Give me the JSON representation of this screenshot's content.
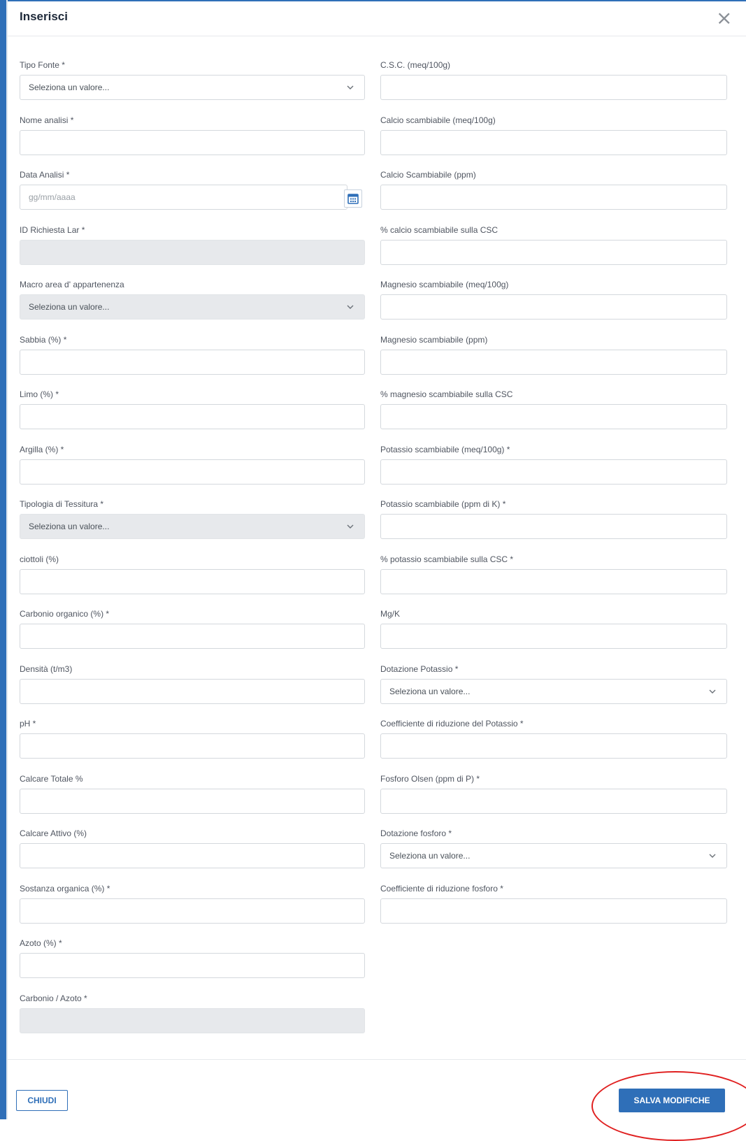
{
  "dialog": {
    "title": "Inserisci",
    "close_glyph": "×"
  },
  "left_column": [
    {
      "label": "Tipo Fonte *",
      "type": "select",
      "value": "Seleziona un valore..."
    },
    {
      "label": "Nome analisi *",
      "type": "text",
      "value": ""
    },
    {
      "label": "Data Analisi *",
      "type": "date",
      "placeholder": "gg/mm/aaaa"
    },
    {
      "label": "ID Richiesta Lar *",
      "type": "disabled",
      "value": ""
    },
    {
      "label": "Macro area d' appartenenza",
      "type": "select-disabled",
      "value": "Seleziona un valore..."
    },
    {
      "label": "Sabbia (%) *",
      "type": "text",
      "value": ""
    },
    {
      "label": "Limo (%) *",
      "type": "text",
      "value": ""
    },
    {
      "label": "Argilla (%) *",
      "type": "text",
      "value": ""
    },
    {
      "label": "Tipologia di Tessitura *",
      "type": "select-disabled",
      "value": "Seleziona un valore..."
    },
    {
      "label": "ciottoli (%)",
      "type": "text",
      "value": ""
    },
    {
      "label": "Carbonio organico (%) *",
      "type": "text",
      "value": ""
    },
    {
      "label": "Densità (t/m3)",
      "type": "text",
      "value": ""
    },
    {
      "label": "pH *",
      "type": "text",
      "value": ""
    },
    {
      "label": "Calcare Totale %",
      "type": "text",
      "value": ""
    },
    {
      "label": "Calcare Attivo (%)",
      "type": "text",
      "value": ""
    },
    {
      "label": "Sostanza organica (%) *",
      "type": "text",
      "value": ""
    },
    {
      "label": "Azoto (%) *",
      "type": "text",
      "value": ""
    },
    {
      "label": "Carbonio / Azoto *",
      "type": "disabled",
      "value": ""
    }
  ],
  "right_column": [
    {
      "label": "C.S.C. (meq/100g)",
      "type": "text",
      "value": ""
    },
    {
      "label": "Calcio scambiabile (meq/100g)",
      "type": "text",
      "value": ""
    },
    {
      "label": "Calcio Scambiabile (ppm)",
      "type": "text",
      "value": ""
    },
    {
      "label": "% calcio scambiabile sulla CSC",
      "type": "text",
      "value": ""
    },
    {
      "label": "Magnesio scambiabile (meq/100g)",
      "type": "text",
      "value": ""
    },
    {
      "label": "Magnesio scambiabile (ppm)",
      "type": "text",
      "value": ""
    },
    {
      "label": "% magnesio scambiabile sulla CSC",
      "type": "text",
      "value": ""
    },
    {
      "label": "Potassio scambiabile (meq/100g) *",
      "type": "text",
      "value": ""
    },
    {
      "label": "Potassio scambiabile (ppm di K) *",
      "type": "text",
      "value": ""
    },
    {
      "label": "% potassio scambiabile sulla CSC *",
      "type": "text",
      "value": ""
    },
    {
      "label": "Mg/K",
      "type": "text",
      "value": ""
    },
    {
      "label": "Dotazione Potassio *",
      "type": "select",
      "value": "Seleziona un valore..."
    },
    {
      "label": "Coefficiente di riduzione del Potassio *",
      "type": "text",
      "value": ""
    },
    {
      "label": "Fosforo Olsen (ppm di P) *",
      "type": "text",
      "value": ""
    },
    {
      "label": "Dotazione fosforo *",
      "type": "select",
      "value": "Seleziona un valore..."
    },
    {
      "label": "Coefficiente di riduzione fosforo *",
      "type": "text",
      "value": ""
    }
  ],
  "footer": {
    "close_label": "CHIUDI",
    "save_label": "SALVA MODIFICHE"
  },
  "colors": {
    "primary": "#2f6fb8",
    "annotation": "#e02020",
    "disabled_bg": "#e7e9ec"
  }
}
